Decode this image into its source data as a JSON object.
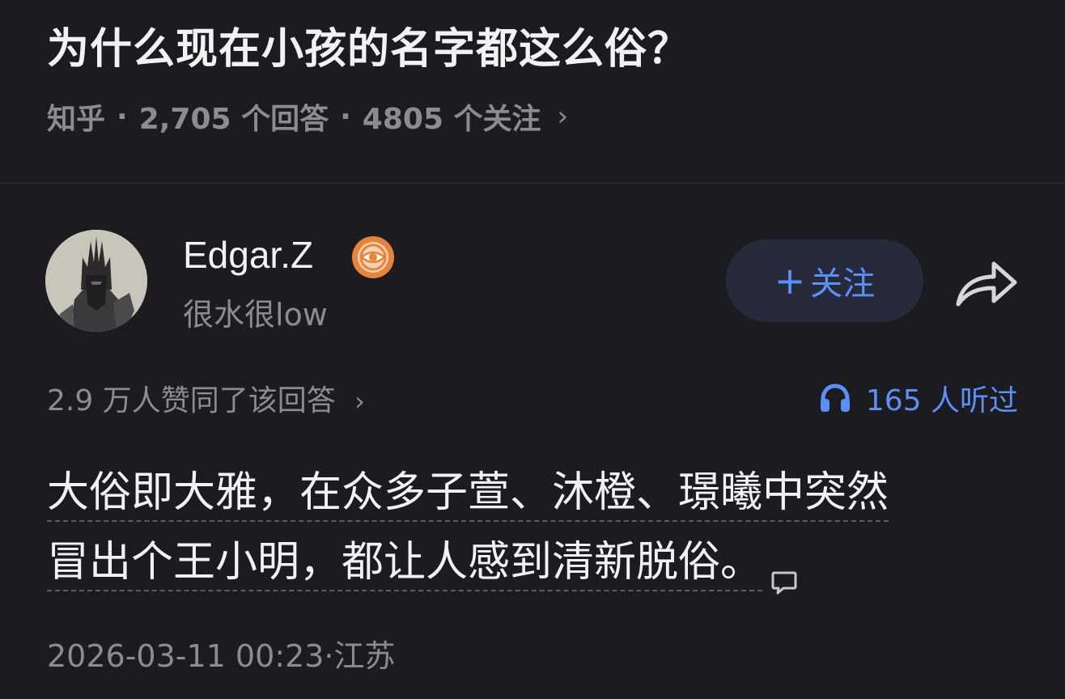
{
  "question": {
    "title": "为什么现在小孩的名字都这么俗？",
    "site": "知乎",
    "dot": "·",
    "answers_count": "2,705 个回答",
    "followers_count": "4805 个关注",
    "chevron": "›"
  },
  "author": {
    "name": "Edgar.Z",
    "bio": "很水很low",
    "badge_icon": "verified-eye-badge",
    "avatar_icon": "dark-knight-helmet-avatar"
  },
  "actions": {
    "follow_plus": "+",
    "follow_label": "关注",
    "share_icon": "share-arrow-icon"
  },
  "stats": {
    "likes": "2.9 万人赞同了该回答",
    "chevron": "›",
    "listens": "165 人听过",
    "listen_icon": "headphones-icon"
  },
  "answer": {
    "line1": "大俗即大雅，在众多子萱、沐橙、璟曦中突然",
    "line2": "冒出个王小明，都让人感到清新脱俗。"
  },
  "meta": {
    "timestamp": "2026-03-11 00:23·江苏"
  },
  "colors": {
    "background": "#1c1c20",
    "accent": "#5b8ff9",
    "muted_text": "#8b8b92",
    "follow_button_bg": "#262a3a",
    "badge_orange": "#e8843a"
  }
}
